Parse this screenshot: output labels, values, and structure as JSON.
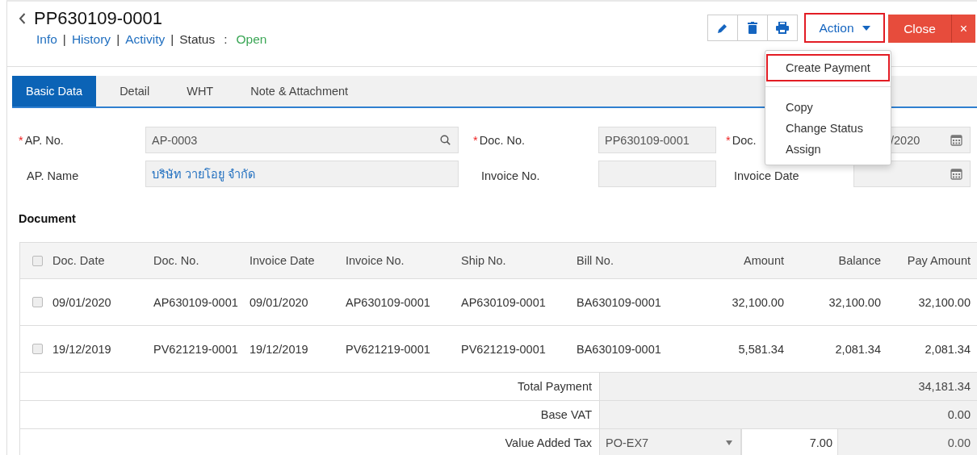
{
  "header": {
    "title": "PP630109-0001",
    "links": [
      {
        "label": "Info",
        "separator": "|"
      },
      {
        "label": "History",
        "separator": "|"
      },
      {
        "label": "Activity",
        "separator": "|"
      }
    ],
    "status_label": "Status",
    "status_separator": ":",
    "status_value": "Open"
  },
  "toolbar": {
    "action": {
      "label": "Action",
      "highlighted": true
    },
    "close": {
      "label": "Close",
      "close_icon": "×"
    }
  },
  "action_menu": {
    "sections": [
      [
        {
          "label": "Create Payment",
          "highlighted": true
        }
      ],
      [
        {
          "label": "Copy",
          "highlighted": false
        },
        {
          "label": "Change Status",
          "highlighted": false
        },
        {
          "label": "Assign",
          "highlighted": false
        }
      ]
    ]
  },
  "tabs": [
    {
      "label": "Basic Data",
      "selected": true
    },
    {
      "label": "Detail",
      "selected": false
    },
    {
      "label": "WHT",
      "selected": false
    },
    {
      "label": "Note & Attachment",
      "selected": false
    }
  ],
  "form": {
    "rows": [
      [
        {
          "required_mark": "*",
          "label": "AP. No.",
          "value": "AP-0003",
          "kind": "search",
          "link": false
        },
        {
          "required_mark": "*",
          "label": "Doc. No.",
          "value": "PP630109-0001",
          "kind": "text",
          "link": false
        },
        {
          "required_mark": "*",
          "label": "Doc.",
          "value": "/2020",
          "kind": "date",
          "link": false
        }
      ],
      [
        {
          "label": "AP. Name",
          "value": "บริษัท วายโอยู จำกัด",
          "kind": "text",
          "link": true
        },
        {
          "label": "Invoice No.",
          "kind": "text"
        },
        {
          "label": "Invoice Date",
          "kind": "date"
        }
      ]
    ]
  },
  "document": {
    "heading": "Document",
    "table": {
      "header_checked": false,
      "columns": [
        {
          "label": "Doc. Date",
          "numeric": false
        },
        {
          "label": "Doc. No.",
          "numeric": false
        },
        {
          "label": "Invoice Date",
          "numeric": false
        },
        {
          "label": "Invoice No.",
          "numeric": false
        },
        {
          "label": "Ship No.",
          "numeric": false
        },
        {
          "label": "Bill No.",
          "numeric": false
        },
        {
          "label": "Amount",
          "numeric": true
        },
        {
          "label": "Balance",
          "numeric": true
        },
        {
          "label": "Pay Amount",
          "numeric": true
        }
      ],
      "rows": [
        {
          "checked": false,
          "cells": [
            "09/01/2020",
            "AP630109-0001",
            "09/01/2020",
            "AP630109-0001",
            "AP630109-0001",
            "BA630109-0001",
            "32,100.00",
            "32,100.00",
            "32,100.00"
          ]
        },
        {
          "checked": false,
          "cells": [
            "19/12/2019",
            "PV621219-0001",
            "19/12/2019",
            "PV621219-0001",
            "PV621219-0001",
            "BA630109-0001",
            "5,581.34",
            "2,081.34",
            "2,081.34"
          ]
        }
      ]
    },
    "summary": [
      {
        "kind": "total",
        "label": "Total Payment",
        "value": "34,181.34"
      },
      {
        "kind": "total",
        "label": "Base VAT",
        "value": "0.00"
      },
      {
        "kind": "vat",
        "label": "Value Added Tax",
        "tax_code": "PO-EX7",
        "rate": "7.00",
        "value": "0.00"
      }
    ]
  }
}
